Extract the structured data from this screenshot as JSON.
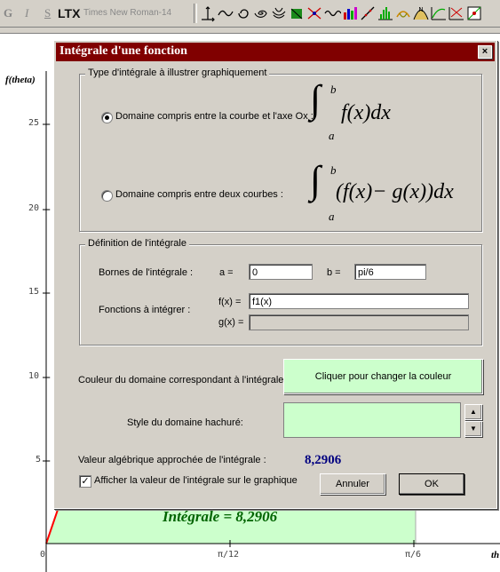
{
  "toolbar": {
    "bold": "G",
    "italic": "I",
    "strike": "S",
    "latex": "LTX",
    "font_name": "Times New Roman-14",
    "icons": [
      "axes-icon",
      "curve-icon",
      "parametric-icon",
      "spiral-icon",
      "surface-icon",
      "region-icon",
      "scatter-icon",
      "wave-icon",
      "histogram-icon",
      "line-icon",
      "distribution-icon",
      "tangent-icon",
      "normal-icon",
      "other-icon"
    ]
  },
  "graph": {
    "y_axis_label": "f(theta)",
    "x_axis_label_right": "th",
    "y_ticks": [
      "25",
      "20",
      "15",
      "10",
      "5"
    ],
    "x_ticks": [
      "0",
      "π/12",
      "π/6"
    ],
    "integral_label": "Intégrale = 8,2906",
    "fill_color": "#ccffcc"
  },
  "dialog": {
    "title": "Intégrale d'une fonction",
    "close_label": "×",
    "type_group_title": "Type d'intégrale à illustrer graphiquement",
    "radio1_label": "Domaine compris entre la courbe et l'axe Ox :",
    "radio2_label": "Domaine compris entre deux courbes :",
    "formula1": {
      "upper": "b",
      "lower": "a",
      "body": "f(x)dx"
    },
    "formula2": {
      "upper": "b",
      "lower": "a",
      "body": "(f(x)− g(x))dx"
    },
    "definition_group_title": "Définition de l'intégrale",
    "bounds_label": "Bornes de l'intégrale :",
    "a_label": "a =",
    "a_value": "0",
    "b_label": "b =",
    "b_value": "pi/6",
    "functions_label": "Fonctions à intégrer :",
    "f_label": "f(x) =",
    "f_value": "f1(x)",
    "g_label": "g(x) =",
    "g_value": "",
    "color_label": "Couleur du domaine correspondant à l'intégrale :",
    "color_button": "Cliquer pour changer la couleur",
    "hatch_label": "Style du domaine hachuré:",
    "value_label": "Valeur algébrique approchée de l'intégrale :",
    "value": "8,2906",
    "checkbox_label": "Afficher la valeur de l'intégrale sur le graphique",
    "checkbox_checked": true,
    "cancel_button": "Annuler",
    "ok_button": "OK",
    "swatch_color": "#ccffcc",
    "value_color": "#000080"
  }
}
